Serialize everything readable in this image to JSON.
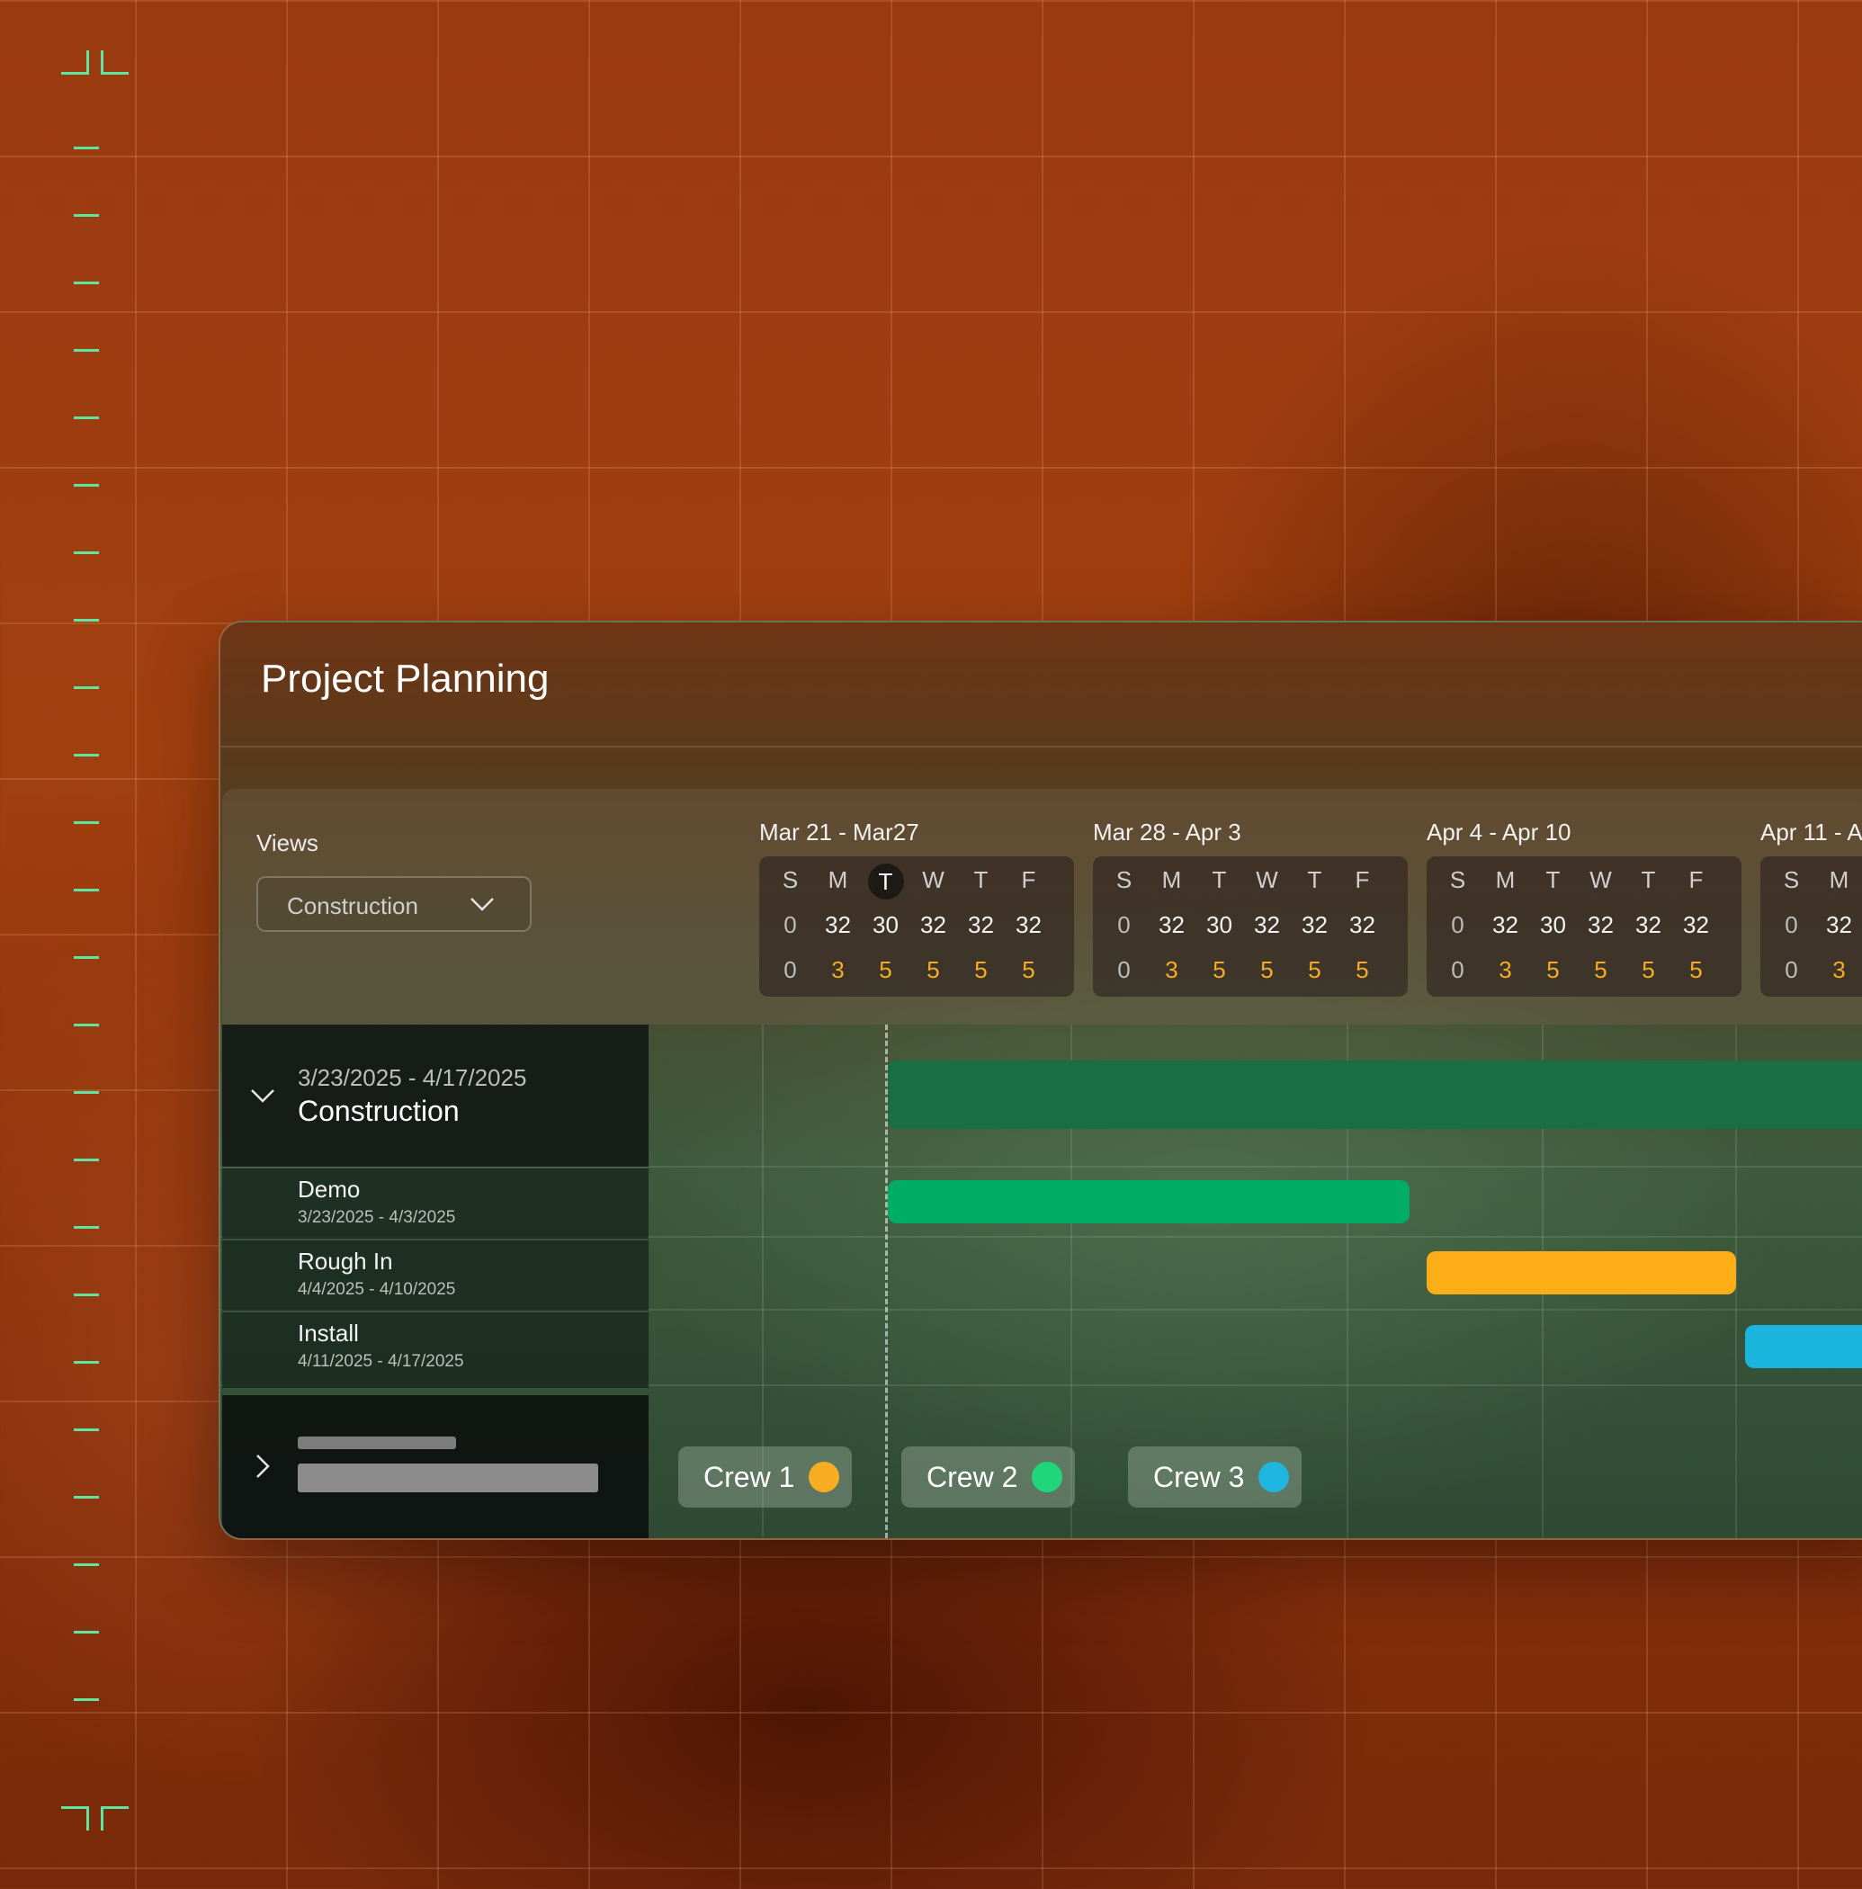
{
  "panel": {
    "title": "Project Planning"
  },
  "views": {
    "label": "Views",
    "selected": "Construction"
  },
  "weeks": [
    {
      "label": "Mar 21 - Mar27",
      "days": [
        "S",
        "M",
        "T",
        "W",
        "T",
        "F"
      ],
      "capacity": [
        "0",
        "32",
        "30",
        "32",
        "32",
        "32"
      ],
      "crew": [
        "0",
        "3",
        "5",
        "5",
        "5",
        "5"
      ],
      "today_index": 2
    },
    {
      "label": "Mar 28 - Apr 3",
      "days": [
        "S",
        "M",
        "T",
        "W",
        "T",
        "F"
      ],
      "capacity": [
        "0",
        "32",
        "30",
        "32",
        "32",
        "32"
      ],
      "crew": [
        "0",
        "3",
        "5",
        "5",
        "5",
        "5"
      ]
    },
    {
      "label": "Apr 4 - Apr 10",
      "days": [
        "S",
        "M",
        "T",
        "W",
        "T",
        "F"
      ],
      "capacity": [
        "0",
        "32",
        "30",
        "32",
        "32",
        "32"
      ],
      "crew": [
        "0",
        "3",
        "5",
        "5",
        "5",
        "5"
      ]
    },
    {
      "label": "Apr 11 - A",
      "days": [
        "S",
        "M"
      ],
      "capacity": [
        "0",
        "32"
      ],
      "crew": [
        "0",
        "3"
      ]
    }
  ],
  "group": {
    "dates": "3/23/2025 - 4/17/2025",
    "name": "Construction"
  },
  "tasks": [
    {
      "name": "Demo",
      "dates": "3/23/2025 - 4/3/2025"
    },
    {
      "name": "Rough In",
      "dates": "4/4/2025 - 4/10/2025"
    },
    {
      "name": "Install",
      "dates": "4/11/2025 - 4/17/2025"
    }
  ],
  "crews": [
    {
      "label": "Crew 1",
      "color": "#f7ac22"
    },
    {
      "label": "Crew 2",
      "color": "#20d67a"
    },
    {
      "label": "Crew 3",
      "color": "#1fb6e0"
    }
  ],
  "colors": {
    "group_bar": "#1a6e44",
    "demo_bar": "#00ad65",
    "rough_in_bar": "#fdae17",
    "install_bar": "#1ab4dc",
    "ruler_accent": "#5ee6a0"
  }
}
